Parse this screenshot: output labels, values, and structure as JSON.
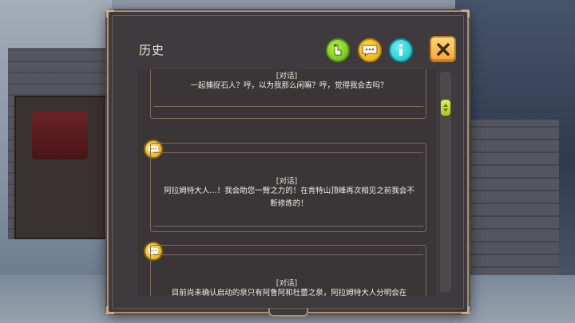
{
  "panel": {
    "title": "历史"
  },
  "header_buttons": [
    {
      "icon": "leaf-cursor-icon",
      "color": "#8fd12a"
    },
    {
      "icon": "speech-bubble-icon",
      "color": "#f4c324"
    },
    {
      "icon": "info-icon",
      "color": "#2fd0d8"
    },
    {
      "icon": "close-icon",
      "color": "#f6b14b"
    }
  ],
  "history": [
    {
      "speaker": "[对话]",
      "message": "一起捕捉石人？哼，以为我那么闲嘛？哼，觉得我会去吗？"
    },
    {
      "speaker": "[对话]",
      "message": "阿拉姆特大人…！我会助您一臂之力的！在肯特山顶峰再次相见之前我会不断修炼的！"
    },
    {
      "speaker": "[对话]",
      "message": "目前尚未确认启动的泉只有阿鲁阿和杜蕾之泉，阿拉姆特大人分明会在"
    }
  ]
}
